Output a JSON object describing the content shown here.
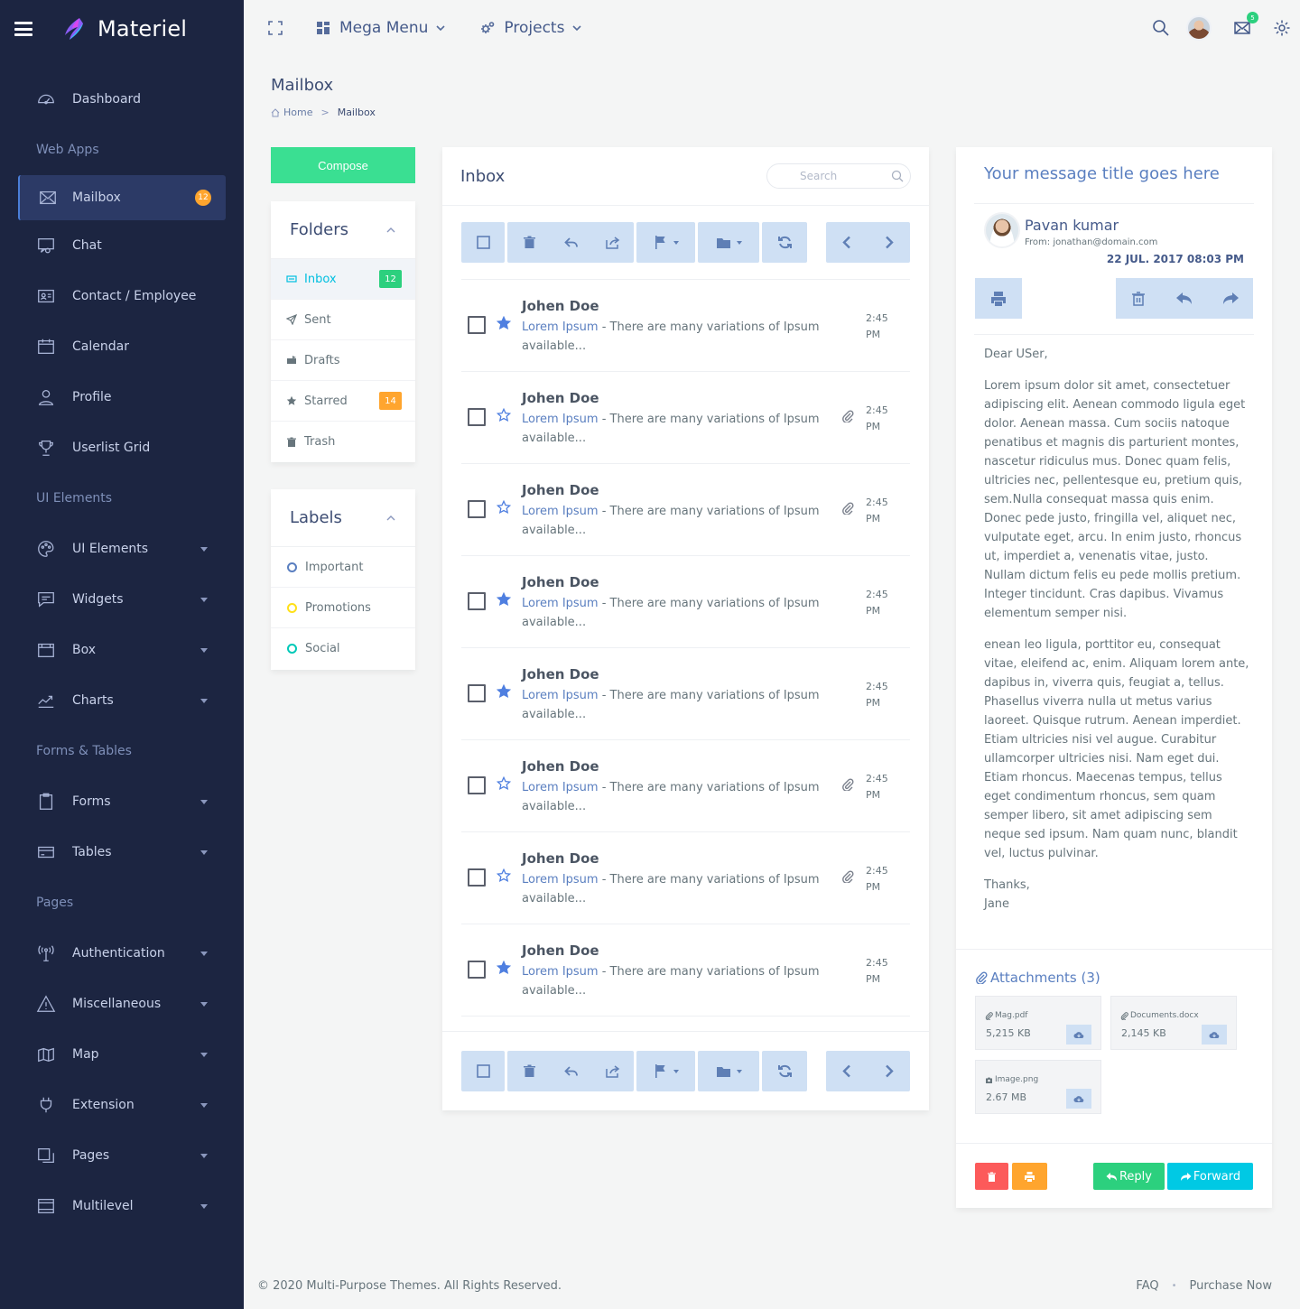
{
  "brand": {
    "name": "Materiel"
  },
  "sidebar": {
    "dashboard": "Dashboard",
    "sec_webapps": "Web Apps",
    "mailbox": "Mailbox",
    "mailbox_badge": "12",
    "chat": "Chat",
    "contact": "Contact / Employee",
    "calendar": "Calendar",
    "profile": "Profile",
    "userlist": "Userlist Grid",
    "sec_ui": "UI Elements",
    "ui_elements": "UI Elements",
    "widgets": "Widgets",
    "box": "Box",
    "charts": "Charts",
    "sec_forms": "Forms & Tables",
    "forms": "Forms",
    "tables": "Tables",
    "sec_pages": "Pages",
    "authentication": "Authentication",
    "misc": "Miscellaneous",
    "map": "Map",
    "extension": "Extension",
    "pages": "Pages",
    "multilevel": "Multilevel"
  },
  "topbar": {
    "mega_menu": "Mega Menu",
    "projects": "Projects",
    "mail_count": "5"
  },
  "page": {
    "title": "Mailbox",
    "crumb_home": "Home",
    "crumb_sep": ">",
    "crumb_current": "Mailbox"
  },
  "compose_label": "Compose",
  "folders": {
    "title": "Folders",
    "inbox": "Inbox",
    "inbox_count": "12",
    "sent": "Sent",
    "drafts": "Drafts",
    "starred": "Starred",
    "starred_count": "14",
    "trash": "Trash"
  },
  "labels": {
    "title": "Labels",
    "important": "Important",
    "important_color": "#5a7fc0",
    "promotions": "Promotions",
    "promotions_color": "#ffe01a",
    "social": "Social",
    "social_color": "#00c9b8"
  },
  "inbox": {
    "title": "Inbox",
    "search_placeholder": "Search",
    "emails": [
      {
        "sender": "Johen Doe",
        "subject": "Lorem Ipsum",
        "preview": " - There are many variations of Ipsum available...",
        "time1": "2:45",
        "time2": "PM",
        "starred": true,
        "attachment": false
      },
      {
        "sender": "Johen Doe",
        "subject": "Lorem Ipsum",
        "preview": " - There are many variations of Ipsum available...",
        "time1": "2:45",
        "time2": "PM",
        "starred": false,
        "attachment": true
      },
      {
        "sender": "Johen Doe",
        "subject": "Lorem Ipsum",
        "preview": " - There are many variations of Ipsum available...",
        "time1": "2:45",
        "time2": "PM",
        "starred": false,
        "attachment": true
      },
      {
        "sender": "Johen Doe",
        "subject": "Lorem Ipsum",
        "preview": " - There are many variations of Ipsum available...",
        "time1": "2:45",
        "time2": "PM",
        "starred": true,
        "attachment": false
      },
      {
        "sender": "Johen Doe",
        "subject": "Lorem Ipsum",
        "preview": " - There are many variations of Ipsum available...",
        "time1": "2:45",
        "time2": "PM",
        "starred": true,
        "attachment": false
      },
      {
        "sender": "Johen Doe",
        "subject": "Lorem Ipsum",
        "preview": " - There are many variations of Ipsum available...",
        "time1": "2:45",
        "time2": "PM",
        "starred": false,
        "attachment": true
      },
      {
        "sender": "Johen Doe",
        "subject": "Lorem Ipsum",
        "preview": " - There are many variations of Ipsum available...",
        "time1": "2:45",
        "time2": "PM",
        "starred": false,
        "attachment": true
      },
      {
        "sender": "Johen Doe",
        "subject": "Lorem Ipsum",
        "preview": " - There are many variations of Ipsum available...",
        "time1": "2:45",
        "time2": "PM",
        "starred": true,
        "attachment": false
      }
    ]
  },
  "reader": {
    "title": "Your message title goes here",
    "sender": "Pavan kumar",
    "from": "From: jonathan@domain.com",
    "date": "22 JUL. 2017 08:03 PM",
    "greeting": "Dear USer,",
    "para1": "Lorem ipsum dolor sit amet, consectetuer adipiscing elit. Aenean commodo ligula eget dolor. Aenean massa. Cum sociis natoque penatibus et magnis dis parturient montes, nascetur ridiculus mus. Donec quam felis, ultricies nec, pellentesque eu, pretium quis, sem.Nulla consequat massa quis enim. Donec pede justo, fringilla vel, aliquet nec, vulputate eget, arcu. In enim justo, rhoncus ut, imperdiet a, venenatis vitae, justo. Nullam dictum felis eu pede mollis pretium. Integer tincidunt. Cras dapibus. Vivamus elementum semper nisi.",
    "para2": "enean leo ligula, porttitor eu, consequat vitae, eleifend ac, enim. Aliquam lorem ante, dapibus in, viverra quis, feugiat a, tellus. Phasellus viverra nulla ut metus varius laoreet. Quisque rutrum. Aenean imperdiet. Etiam ultricies nisi vel augue. Curabitur ullamcorper ultricies nisi. Nam eget dui. Etiam rhoncus. Maecenas tempus, tellus eget condimentum rhoncus, sem quam semper libero, sit amet adipiscing sem neque sed ipsum. Nam quam nunc, blandit vel, luctus pulvinar.",
    "thanks": "Thanks,",
    "signoff": "Jane",
    "attachments_title": "Attachments (3)",
    "attachments": [
      {
        "name": "Mag.pdf",
        "size": "5,215 KB"
      },
      {
        "name": "Documents.docx",
        "size": "2,145 KB"
      },
      {
        "name": "Image.png",
        "size": "2.67 MB"
      }
    ],
    "reply": "Reply",
    "forward": "Forward"
  },
  "footer": {
    "copyright": "© 2020 Multi-Purpose Themes. All Rights Reserved.",
    "faq": "FAQ",
    "dot": "•",
    "purchase": "Purchase Now"
  },
  "colors": {
    "sidebar_bg": "#1c2541",
    "accent_green": "#3adf92",
    "accent_cyan": "#00c9e4",
    "accent_orange": "#ffa52e",
    "danger": "#fc5a5a"
  }
}
